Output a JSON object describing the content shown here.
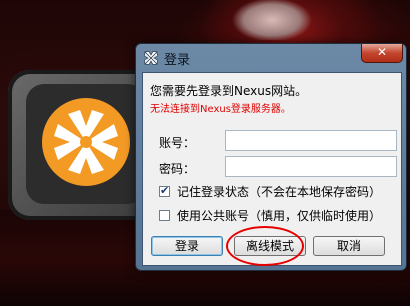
{
  "window": {
    "title": "登录",
    "close_glyph": "✕"
  },
  "message": {
    "line1": "您需要先登录到Nexus网站。",
    "line2": "无法连接到Nexus登录服务器。"
  },
  "form": {
    "account_label": "账号：",
    "account_value": "",
    "password_label": "密码：",
    "password_value": ""
  },
  "options": {
    "remember_label": "记住登录状态（不会在本地保存密码）",
    "remember_checked": true,
    "public_label": "使用公共账号（慎用，仅供临时使用）",
    "public_checked": false,
    "check_glyph": "✔"
  },
  "buttons": {
    "login": "登录",
    "offline": "离线模式",
    "cancel": "取消"
  },
  "colors": {
    "error": "#e00000",
    "logo_orange": "#f39a25",
    "highlight_circle": "#e60000"
  },
  "icons": [
    "nexus-logo-icon",
    "dialog-app-icon",
    "close-icon",
    "checkbox-check-icon"
  ]
}
